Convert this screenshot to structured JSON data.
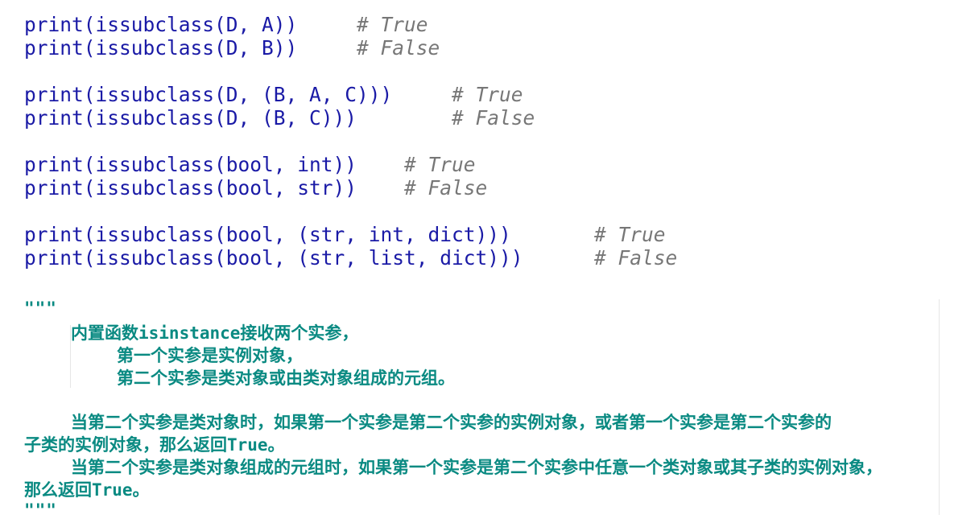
{
  "code_lines": [
    {
      "code": "print(issubclass(D, A))",
      "comment": "# True"
    },
    {
      "code": "print(issubclass(D, B))",
      "comment": "# False"
    },
    {
      "code": "print(issubclass(D, (B, A, C)))",
      "comment": "# True"
    },
    {
      "code": "print(issubclass(D, (B, C)))",
      "comment": "# False"
    },
    {
      "code": "print(issubclass(bool, int))",
      "comment": "# True"
    },
    {
      "code": "print(issubclass(bool, str))",
      "comment": "# False"
    },
    {
      "code": "print(issubclass(bool, (str, int, dict)))",
      "comment": "# True"
    },
    {
      "code": "print(issubclass(bool, (str, list, dict)))",
      "comment": "# False"
    }
  ],
  "docstring": {
    "open_quote": "\"\"\"",
    "close_quote": "\"\"\"",
    "lines": [
      "内置函数isinstance接收两个实参，",
      "第一个实参是实例对象，",
      "第二个实参是类对象或由类对象组成的元组。",
      "当第二个实参是类对象时，如果第一个实参是第二个实参的实例对象，或者第一个实参是第二个实参的",
      "子类的实例对象，那么返回True。",
      "当第二个实参是类对象组成的元组时，如果第一个实参是第二个实参中任意一个类对象或其子类的实例对象，",
      "那么返回True。"
    ]
  },
  "colors": {
    "code": "#1a1aa6",
    "comment": "#777777",
    "docstring": "#0a8a82",
    "background": "#ffffff"
  }
}
